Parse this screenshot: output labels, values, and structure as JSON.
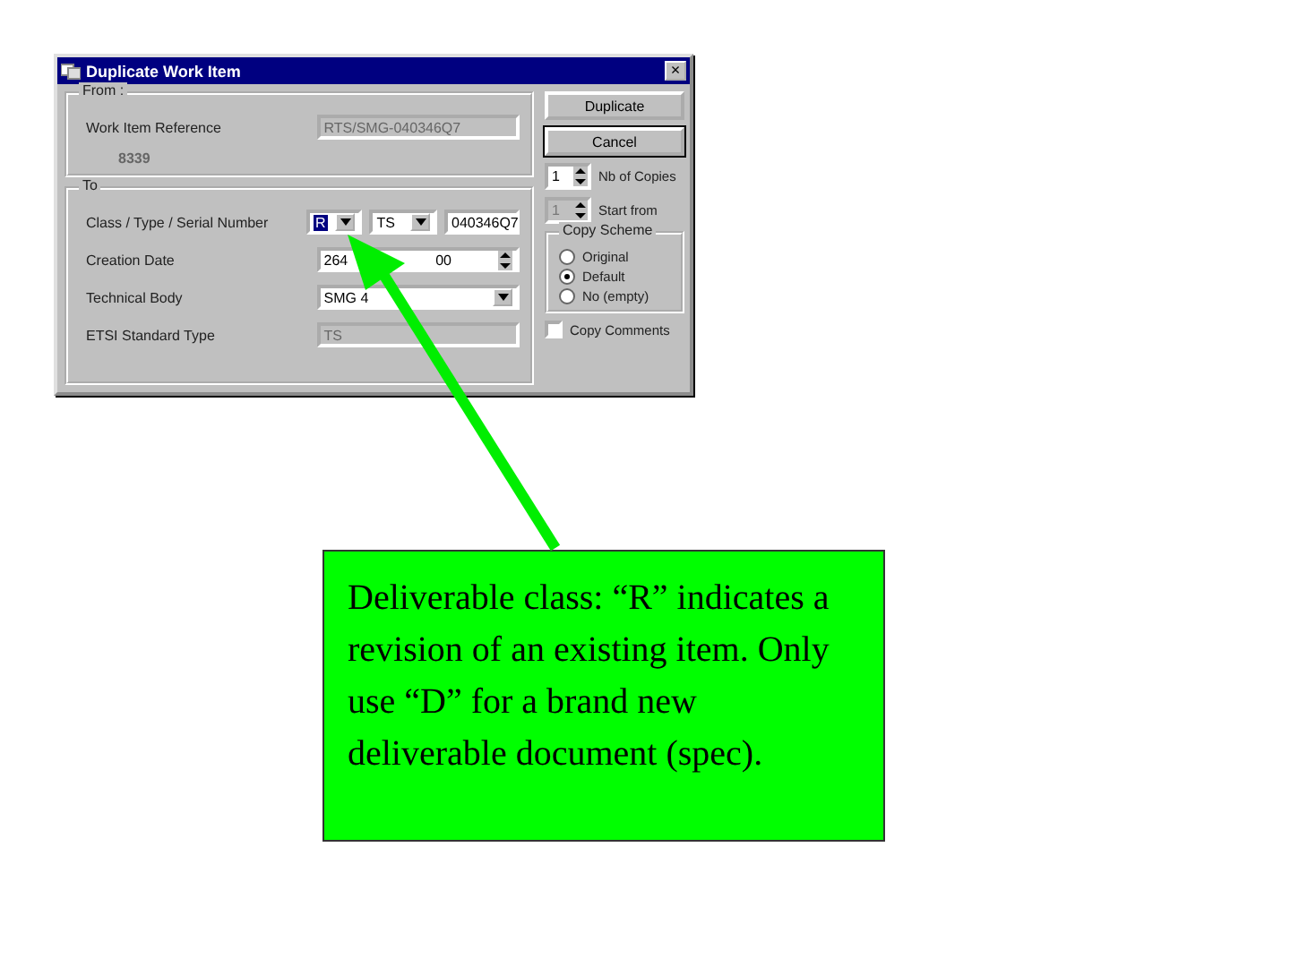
{
  "window": {
    "title": "Duplicate Work Item",
    "close": "×"
  },
  "from": {
    "label": "From :",
    "reference_label": "Work Item Reference",
    "reference_number": "8339",
    "reference_value": "RTS/SMG-040346Q7"
  },
  "to": {
    "label": "To",
    "class_label": "Class / Type / Serial Number",
    "class_value": "R",
    "type_value": "TS",
    "serial_value": "040346Q7",
    "date_label": "Creation Date",
    "date_start": "264",
    "date_end": "00",
    "body_label": "Technical Body",
    "body_value": "SMG 4",
    "standard_label": "ETSI Standard Type",
    "standard_value": "TS"
  },
  "buttons": [
    {
      "label": "Duplicate",
      "focused": false
    },
    {
      "label": "Cancel",
      "focused": true
    }
  ],
  "copies": {
    "label": "Nb of Copies",
    "value": "1"
  },
  "start": {
    "label": "Start from",
    "value": "1",
    "disabled": true
  },
  "scheme": {
    "label": "Copy Scheme",
    "options": [
      {
        "label": "Original",
        "selected": false
      },
      {
        "label": "Default",
        "selected": true
      },
      {
        "label": "No (empty)",
        "selected": false
      }
    ]
  },
  "copy_comments": {
    "label": "Copy Comments",
    "checked": false
  },
  "callout": {
    "text": "Deliverable class: “R” indicates a revision of an existing item.  Only use “D” for a brand new deliverable document (spec)."
  }
}
